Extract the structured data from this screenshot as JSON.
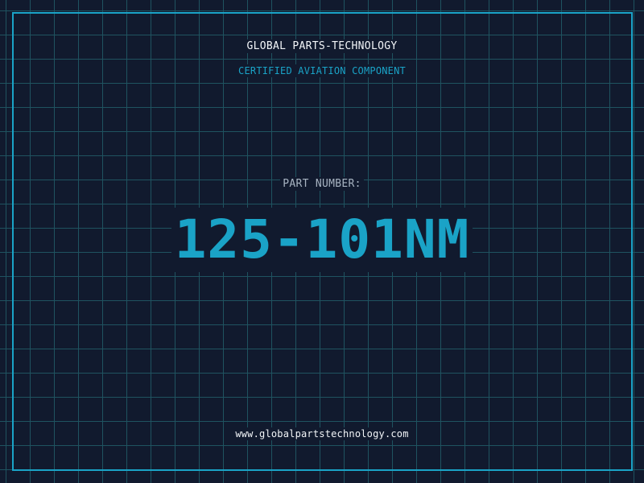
{
  "header": {
    "company": "GLOBAL PARTS-TECHNOLOGY",
    "subtitle": "CERTIFIED AVIATION COMPONENT"
  },
  "part": {
    "label": "PART NUMBER:",
    "number": "125-101NM"
  },
  "footer": {
    "website": "www.globalpartstechnology.com"
  },
  "colors": {
    "background": "#111a2e",
    "grid": "#1f5360",
    "accent": "#1aa3c7",
    "text_primary": "#f2f5f8",
    "text_secondary": "#a8b4c2"
  }
}
